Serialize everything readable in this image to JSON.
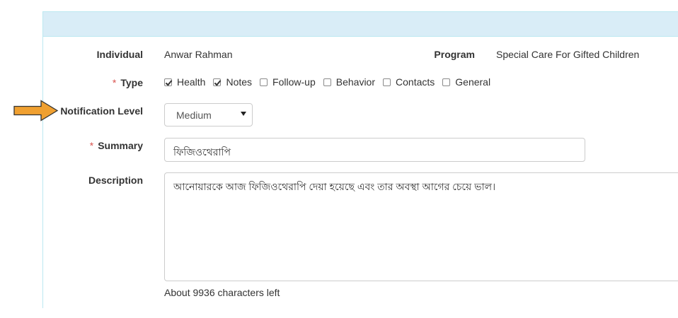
{
  "form": {
    "individual_label": "Individual",
    "individual_value": "Anwar Rahman",
    "program_label": "Program",
    "program_value": "Special Care For Gifted Children",
    "required_mark": "*",
    "type_label": "Type",
    "type_options": [
      {
        "label": "Health",
        "checked": true
      },
      {
        "label": "Notes",
        "checked": true
      },
      {
        "label": "Follow-up",
        "checked": false
      },
      {
        "label": "Behavior",
        "checked": false
      },
      {
        "label": "Contacts",
        "checked": false
      },
      {
        "label": "General",
        "checked": false
      }
    ],
    "notification_label": "Notification Level",
    "notification_value": "Medium",
    "summary_label": "Summary",
    "summary_value": "ফিজিওথেরাপি",
    "description_label": "Description",
    "description_value": "আনোয়ারকে আজ ফিজিওথেরাপি দেয়া হয়েছে এবং তার অবস্থা আগের চেয়ে ভাল।",
    "chars_left": "About 9936 characters left"
  },
  "colors": {
    "panel_header_bg": "#d9edf7",
    "panel_border": "#bce8f1",
    "required": "#d9534f",
    "arrow_fill": "#f0a030",
    "arrow_stroke": "#333333"
  },
  "icons": {
    "annotation_arrow": "arrow-right-icon",
    "select_caret": "caret-down-icon"
  }
}
